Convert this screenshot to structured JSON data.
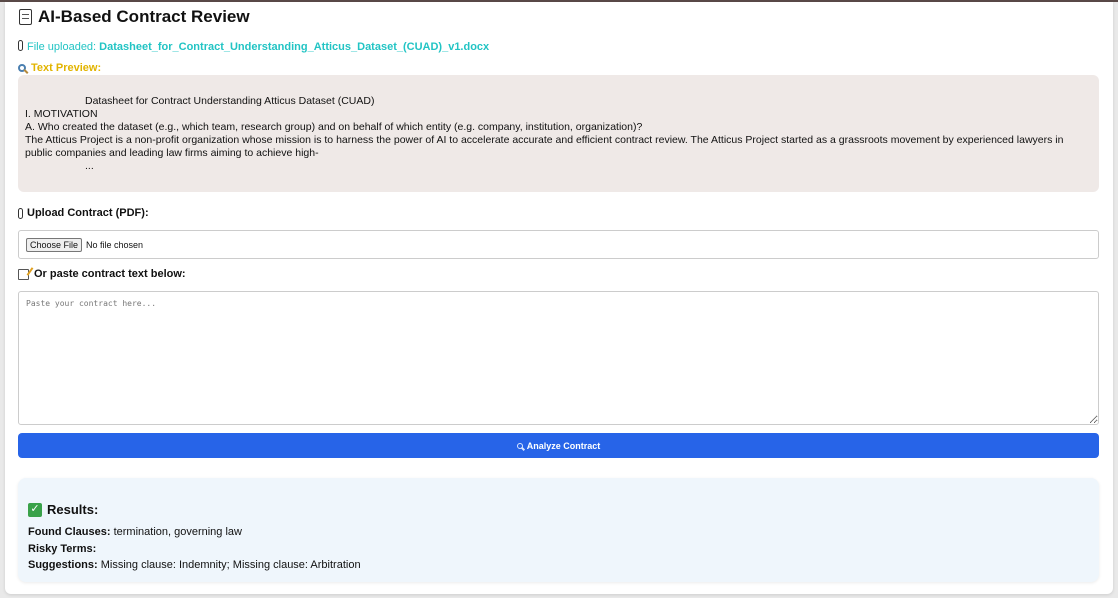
{
  "app": {
    "title": "AI-Based Contract Review"
  },
  "upload_status": {
    "prefix": "File uploaded:",
    "filename": "Datasheet_for_Contract_Understanding_Atticus_Dataset_(CUAD)_v1.docx"
  },
  "preview": {
    "label": "Text Preview:",
    "lines": [
      "Datasheet for Contract Understanding Atticus Dataset (CUAD)",
      "I. MOTIVATION",
      "A. Who created the dataset (e.g., which team, research group) and on behalf of which entity (e.g. company, institution, organization)?",
      "The Atticus Project is a non-profit organization whose mission is to harness the power of AI to accelerate accurate and efficient contract review. The Atticus Project started as a grassroots movement by experienced lawyers in public companies and leading law firms aiming to achieve high-",
      "..."
    ]
  },
  "upload_section": {
    "label": "Upload Contract (PDF):",
    "choose_button": "Choose File",
    "file_status": "No file chosen"
  },
  "paste_section": {
    "label": "Or paste contract text below:",
    "placeholder": "Paste your contract here..."
  },
  "analyze_button": {
    "label": "Analyze Contract"
  },
  "results": {
    "title": "Results:",
    "found_label": "Found Clauses:",
    "found_value": "termination, governing law",
    "risky_label": "Risky Terms:",
    "risky_value": "",
    "suggestions_label": "Suggestions:",
    "suggestions_value": "Missing clause: Indemnity; Missing clause: Arbitration"
  },
  "colors": {
    "accent_button": "#2764e8",
    "upload_status": "#22c4c4",
    "preview_label": "#e2b400",
    "preview_bg": "#efe9e7",
    "results_bg": "#eff6fc"
  }
}
